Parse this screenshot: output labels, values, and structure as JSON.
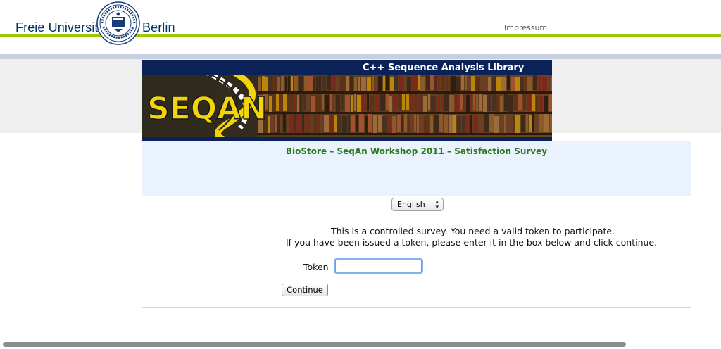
{
  "header": {
    "university_left": "Freie Universität",
    "university_right": "Berlin",
    "impressum_link": "Impressum"
  },
  "banner": {
    "title": "C++ Sequence Analysis Library",
    "logo_text": "SEQAN"
  },
  "survey": {
    "title": "BioStore – SeqAn Workshop 2011 – Satisfaction Survey",
    "language_select": {
      "selected": "English"
    },
    "message_line1": "This is a controlled survey. You need a valid token to participate.",
    "message_line2": "If you have been issued a token, please enter it in the box below and click continue.",
    "token_label": "Token",
    "token_value": "",
    "continue_label": "Continue"
  },
  "colors": {
    "green_bar": "#99cc00",
    "banner_navy": "#0b2258",
    "survey_title": "#2a7a1a",
    "survey_header_bg": "#eaf2fd"
  }
}
